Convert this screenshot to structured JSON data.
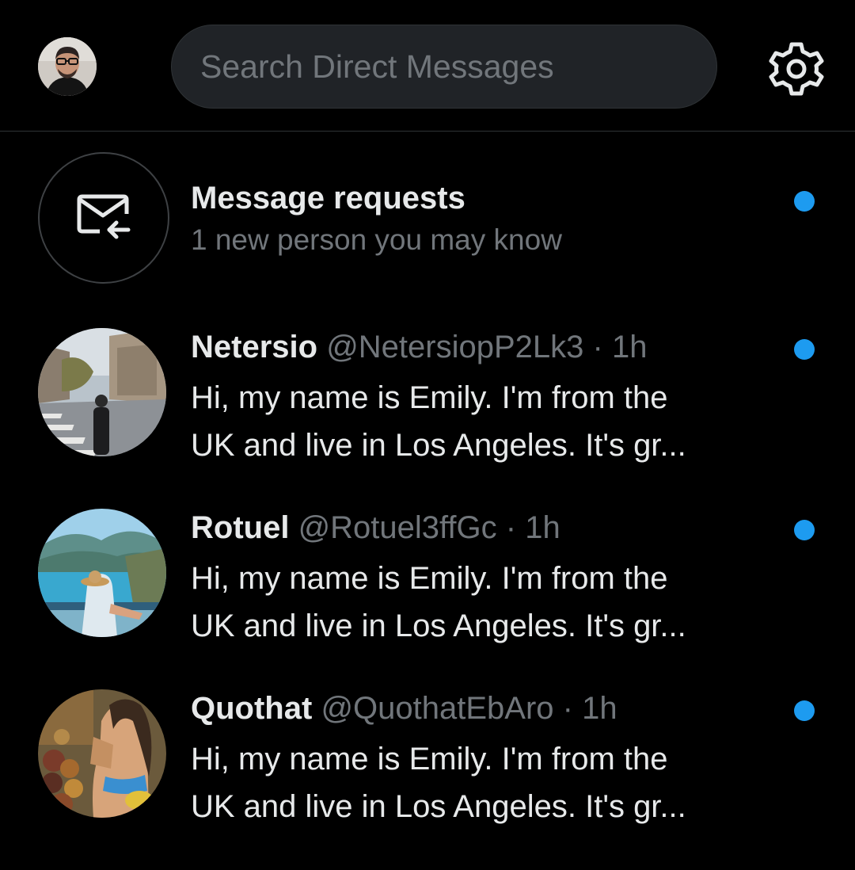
{
  "header": {
    "search": {
      "placeholder": "Search Direct Messages"
    },
    "settings_icon": "gear-icon"
  },
  "requests": {
    "title": "Message requests",
    "subtitle": "1 new person you may know",
    "icon": "envelope-arrow-icon"
  },
  "conversations": [
    {
      "name": "Netersio",
      "handle": "@NetersiopP2Lk3",
      "separator": "·",
      "time": "1h",
      "preview_line1": "Hi, my name is Emily. I'm from the",
      "preview_line2": "UK and live in Los Angeles. It's gr..."
    },
    {
      "name": "Rotuel",
      "handle": "@Rotuel3ffGc",
      "separator": "·",
      "time": "1h",
      "preview_line1": "Hi, my name is Emily. I'm from the",
      "preview_line2": "UK and live in Los Angeles. It's gr..."
    },
    {
      "name": "Quothat",
      "handle": "@QuothatEbAro",
      "separator": "·",
      "time": "1h",
      "preview_line1": "Hi, my name is Emily. I'm from the",
      "preview_line2": "UK and live in Los Angeles. It's gr..."
    }
  ],
  "colors": {
    "background": "#000000",
    "unread_dot": "#1d9bf0",
    "secondary_text": "#71767b",
    "primary_text": "#e7e9ea",
    "search_bg": "#202327"
  }
}
